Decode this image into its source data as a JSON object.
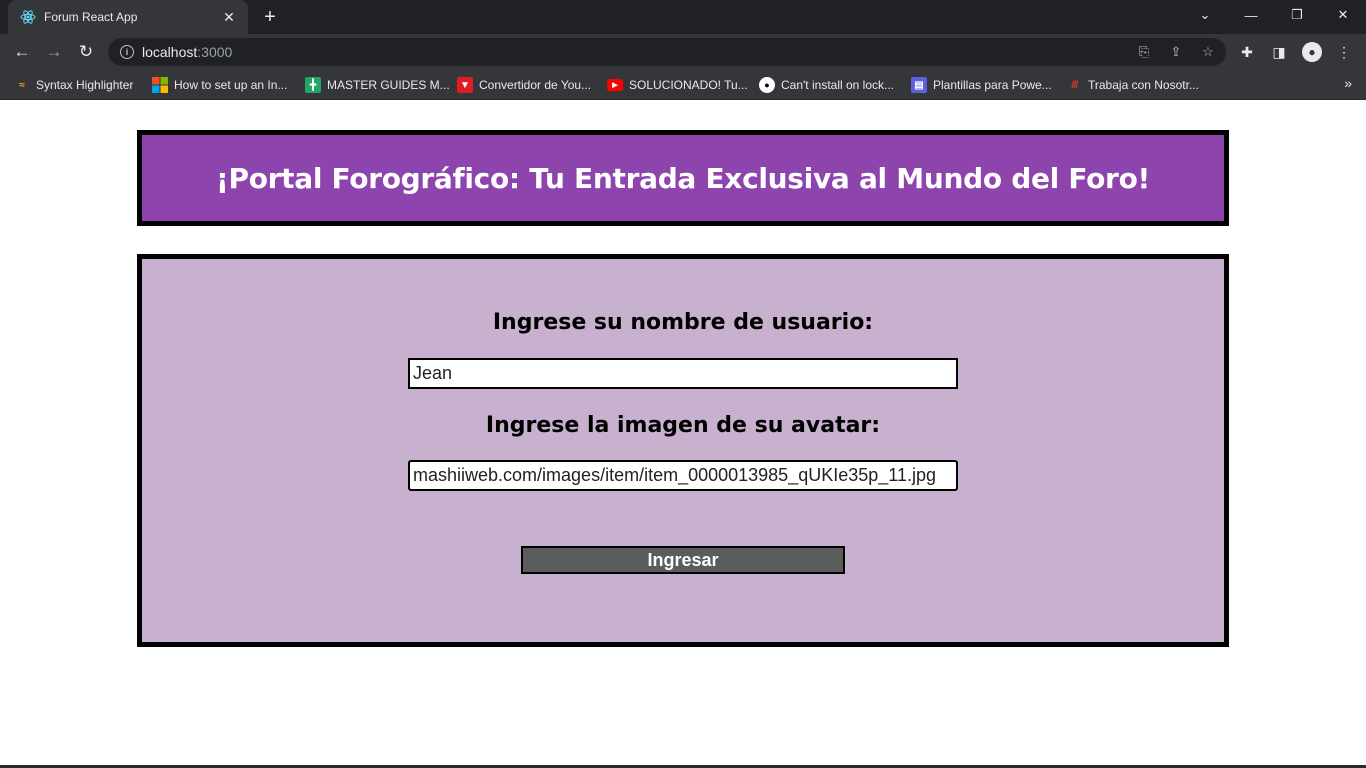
{
  "browser": {
    "tab_title": "Forum React App",
    "new_tab": "+",
    "url_host": "localhost",
    "url_port": ":3000",
    "bookmarks": [
      {
        "label": "Syntax Highlighter",
        "icon": "syntax-highlighter-icon",
        "color": "#f5a623"
      },
      {
        "label": "How to set up an In...",
        "icon": "microsoft-icon",
        "color": "#f25022"
      },
      {
        "label": "MASTER GUIDES M...",
        "icon": "sheets-icon",
        "color": "#23a566"
      },
      {
        "label": "Convertidor de You...",
        "icon": "download-icon",
        "color": "#e01b24"
      },
      {
        "label": "SOLUCIONADO! Tu...",
        "icon": "youtube-icon",
        "color": "#ff0000"
      },
      {
        "label": "Can't install on lock...",
        "icon": "github-icon",
        "color": "#ffffff"
      },
      {
        "label": "Plantillas para Powe...",
        "icon": "slides-icon",
        "color": "#5b5fe0"
      },
      {
        "label": "Trabaja con Nosotr...",
        "icon": "brand-icon",
        "color": "#c0392b"
      }
    ]
  },
  "page": {
    "title": "¡Portal Forográfico: Tu Entrada Exclusiva al Mundo del Foro!",
    "username_label": "Ingrese su nombre de usuario:",
    "username_value": "Jean",
    "avatar_label": "Ingrese la imagen de su avatar:",
    "avatar_value": "mashiiweb.com/images/item/item_0000013985_qUKIe35p_11.jpg",
    "submit_label": "Ingresar"
  },
  "colors": {
    "banner": "#8e44ad",
    "form_background": "#c8b0cf",
    "button": "#5c5c5c"
  }
}
